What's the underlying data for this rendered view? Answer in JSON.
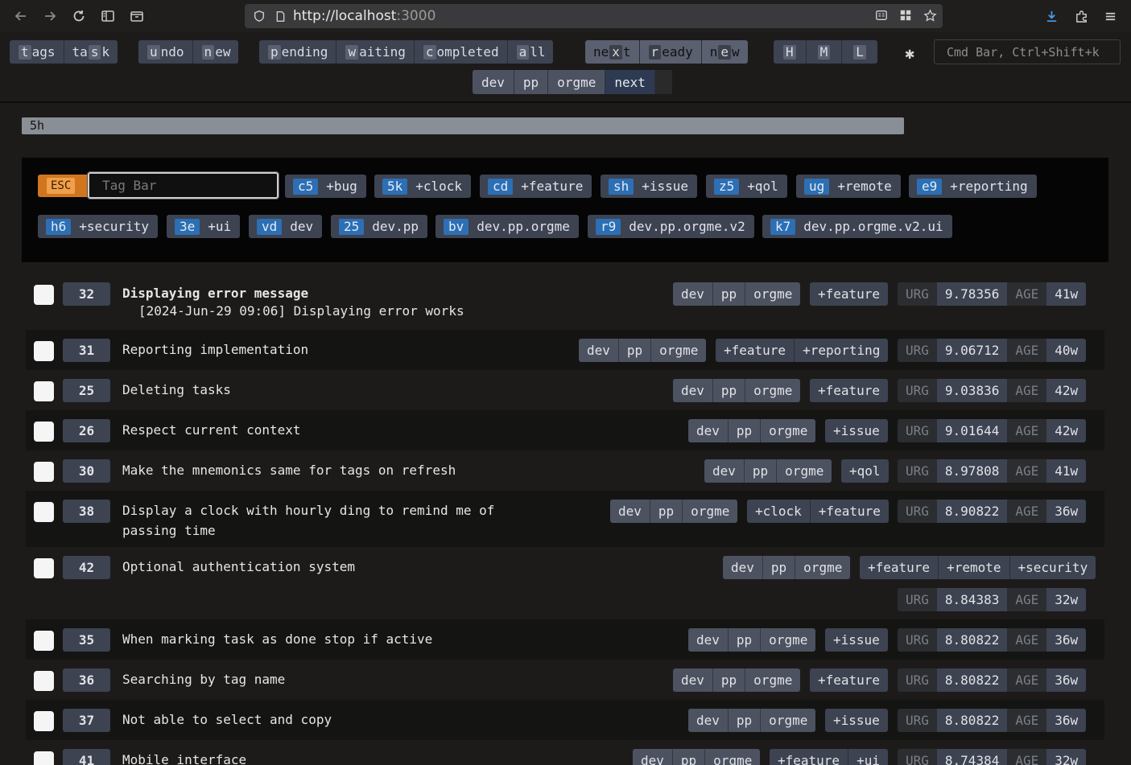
{
  "browser": {
    "url_host": "http://localhost",
    "url_port": ":3000"
  },
  "topbar": {
    "groups": [
      {
        "buttons": [
          {
            "key": "t",
            "rest": "ags"
          },
          {
            "pre": "ta",
            "key": "s",
            "rest": "k"
          }
        ]
      },
      {
        "buttons": [
          {
            "key": "u",
            "rest": "ndo"
          },
          {
            "key": "n",
            "rest": "ew"
          }
        ]
      },
      {
        "buttons": [
          {
            "key": "p",
            "rest": "ending"
          },
          {
            "key": "w",
            "rest": "aiting"
          },
          {
            "key": "c",
            "rest": "ompleted"
          },
          {
            "key": "a",
            "rest": "ll"
          }
        ]
      },
      {
        "buttons": [
          {
            "pre": "ne",
            "key": "x",
            "rest": "t"
          },
          {
            "key": "r",
            "rest": "eady"
          },
          {
            "pre": "n",
            "key": "e",
            "rest": "w"
          }
        ]
      },
      {
        "buttons": [
          {
            "key": "H",
            "rest": ""
          },
          {
            "key": "M",
            "rest": ""
          },
          {
            "key": "L",
            "rest": ""
          }
        ]
      }
    ],
    "context": [
      "dev",
      "pp",
      "orgme",
      "next"
    ],
    "cmd_placeholder": "Cmd Bar, Ctrl+Shift+k"
  },
  "progress": {
    "label": "5h",
    "value": 1.0
  },
  "tagbar": {
    "esc_label": "ESC",
    "placeholder": "Tag Bar",
    "tags": [
      {
        "key": "c5",
        "name": "+bug"
      },
      {
        "key": "5k",
        "name": "+clock"
      },
      {
        "key": "cd",
        "name": "+feature"
      },
      {
        "key": "sh",
        "name": "+issue"
      },
      {
        "key": "z5",
        "name": "+qol"
      },
      {
        "key": "ug",
        "name": "+remote"
      },
      {
        "key": "e9",
        "name": "+reporting"
      },
      {
        "key": "h6",
        "name": "+security"
      },
      {
        "key": "3e",
        "name": "+ui"
      },
      {
        "key": "vd",
        "name": "dev"
      },
      {
        "key": "25",
        "name": "dev.pp"
      },
      {
        "key": "bv",
        "name": "dev.pp.orgme"
      },
      {
        "key": "r9",
        "name": "dev.pp.orgme.v2"
      },
      {
        "key": "k7",
        "name": "dev.pp.orgme.v2.ui"
      }
    ]
  },
  "tasks": [
    {
      "id": "32",
      "desc": "Displaying error message",
      "annotation": "[2024-Jun-29 09:06] Displaying error works",
      "project": [
        "dev",
        "pp",
        "orgme"
      ],
      "tags": [
        "+feature"
      ],
      "urg": "9.78356",
      "age": "41w"
    },
    {
      "id": "31",
      "desc": "Reporting implementation",
      "project": [
        "dev",
        "pp",
        "orgme"
      ],
      "tags": [
        "+feature",
        "+reporting"
      ],
      "urg": "9.06712",
      "age": "40w"
    },
    {
      "id": "25",
      "desc": "Deleting tasks",
      "project": [
        "dev",
        "pp",
        "orgme"
      ],
      "tags": [
        "+feature"
      ],
      "urg": "9.03836",
      "age": "42w"
    },
    {
      "id": "26",
      "desc": "Respect current context",
      "project": [
        "dev",
        "pp",
        "orgme"
      ],
      "tags": [
        "+issue"
      ],
      "urg": "9.01644",
      "age": "42w"
    },
    {
      "id": "30",
      "desc": "Make the mnemonics same for tags on refresh",
      "project": [
        "dev",
        "pp",
        "orgme"
      ],
      "tags": [
        "+qol"
      ],
      "urg": "8.97808",
      "age": "41w"
    },
    {
      "id": "38",
      "desc": "Display a clock with hourly ding to remind me of\npassing time",
      "project": [
        "dev",
        "pp",
        "orgme"
      ],
      "tags": [
        "+clock",
        "+feature"
      ],
      "urg": "8.90822",
      "age": "36w"
    },
    {
      "id": "42",
      "desc": "Optional authentication system",
      "project": [
        "dev",
        "pp",
        "orgme"
      ],
      "tags": [
        "+feature",
        "+remote",
        "+security"
      ],
      "urg": "8.84383",
      "age": "32w"
    },
    {
      "id": "35",
      "desc": "When marking task as done stop if active",
      "project": [
        "dev",
        "pp",
        "orgme"
      ],
      "tags": [
        "+issue"
      ],
      "urg": "8.80822",
      "age": "36w"
    },
    {
      "id": "36",
      "desc": "Searching by tag name",
      "project": [
        "dev",
        "pp",
        "orgme"
      ],
      "tags": [
        "+feature"
      ],
      "urg": "8.80822",
      "age": "36w"
    },
    {
      "id": "37",
      "desc": "Not able to select and copy",
      "project": [
        "dev",
        "pp",
        "orgme"
      ],
      "tags": [
        "+issue"
      ],
      "urg": "8.80822",
      "age": "36w"
    },
    {
      "id": "41",
      "desc": "Mobile interface",
      "project": [
        "dev",
        "pp",
        "orgme"
      ],
      "tags": [
        "+feature",
        "+ui"
      ],
      "urg": "8.74384",
      "age": "32w"
    }
  ],
  "labels": {
    "urg": "URG",
    "age": "AGE"
  }
}
